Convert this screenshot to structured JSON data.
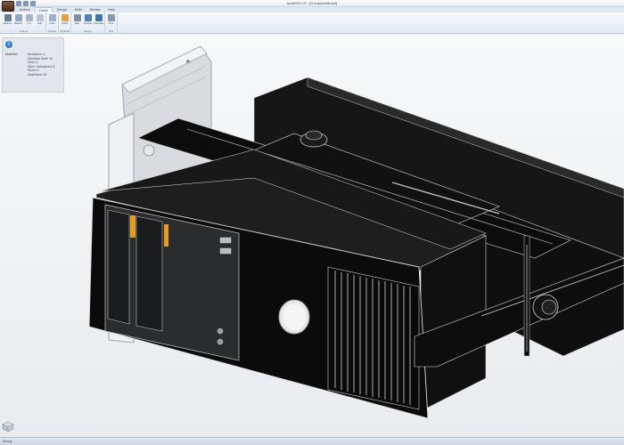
{
  "window": {
    "title": "AutoFEG 07 - [ComputerMount]"
  },
  "ribbon": {
    "tabs": [
      {
        "label": "Archive",
        "active": false
      },
      {
        "label": "Home",
        "active": true
      },
      {
        "label": "Design",
        "active": false
      },
      {
        "label": "Mold",
        "active": false
      },
      {
        "label": "Review",
        "active": false
      },
      {
        "label": "Help",
        "active": false
      }
    ],
    "groups": [
      {
        "name": "Settings",
        "buttons": [
          {
            "label": "Machine",
            "icon": "machine-icon",
            "color": "#6f7c8e"
          },
          {
            "label": "Material",
            "icon": "material-icon",
            "color": "#8fa7c4"
          },
          {
            "label": "Cut",
            "icon": "cut-icon",
            "color": "#a8b6c8"
          },
          {
            "label": "Edit",
            "icon": "edit-icon",
            "color": "#b8c5d6"
          }
        ]
      },
      {
        "name": "Drawing",
        "buttons": [
          {
            "label": "Draw",
            "icon": "draw-icon",
            "color": "#9db0c9"
          }
        ]
      },
      {
        "name": "3D Model",
        "buttons": [
          {
            "label": "Unfold",
            "icon": "unfold-icon",
            "color": "#e1a23a"
          }
        ]
      },
      {
        "name": "Nesting",
        "buttons": [
          {
            "label": "Nest",
            "icon": "nest-icon",
            "color": "#7f8fa6"
          },
          {
            "label": "Multiple",
            "icon": "multiple-icon",
            "color": "#4f7fc0"
          },
          {
            "label": "Quantities",
            "icon": "quantities-icon",
            "color": "#3f72b8"
          }
        ]
      },
      {
        "name": "Print",
        "buttons": [
          {
            "label": "Print",
            "icon": "print-icon",
            "color": "#8b99ad"
          }
        ]
      }
    ]
  },
  "info_panel": {
    "title": "Material:",
    "materials": [
      "Aluminium: 1",
      "Stainless Steel: 10",
      "Steel: 0",
      "Steel, Galvanized: 8",
      "Wood: 0",
      "Undefined: 15"
    ]
  },
  "status": {
    "text": "Ready"
  }
}
